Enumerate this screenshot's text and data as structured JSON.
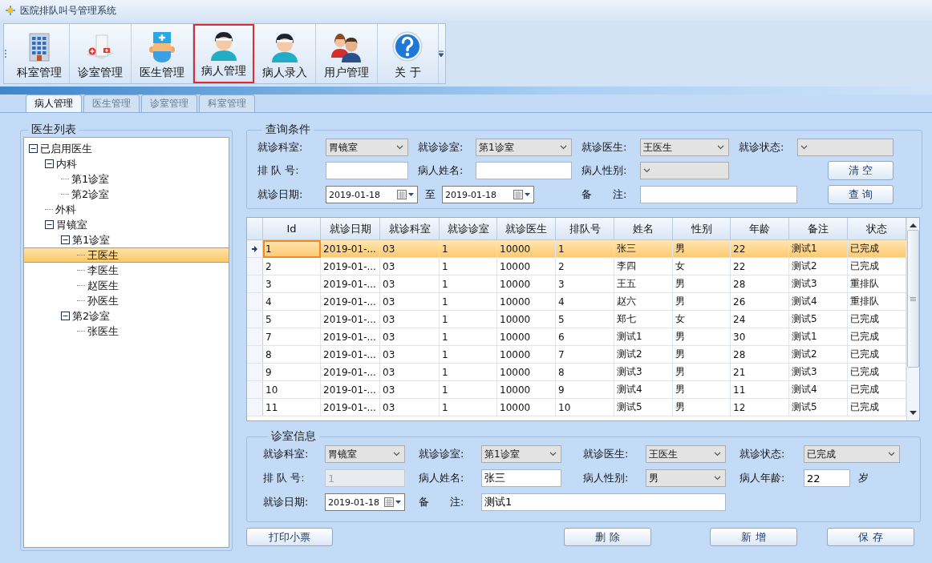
{
  "window": {
    "title": "医院排队叫号管理系统"
  },
  "toolbar": [
    {
      "kind": "building",
      "label": "科室管理",
      "selected": false
    },
    {
      "kind": "clinic",
      "label": "诊室管理",
      "selected": false
    },
    {
      "kind": "doctor",
      "label": "医生管理",
      "selected": false
    },
    {
      "kind": "patient",
      "label": "病人管理",
      "selected": true
    },
    {
      "kind": "patient",
      "label": "病人录入",
      "selected": false
    },
    {
      "kind": "users",
      "label": "用户管理",
      "selected": false
    },
    {
      "kind": "help",
      "label": "关 于",
      "selected": false
    }
  ],
  "tabs": [
    {
      "label": "病人管理",
      "selected": true
    },
    {
      "label": "医生管理",
      "selected": false
    },
    {
      "label": "诊室管理",
      "selected": false
    },
    {
      "label": "科室管理",
      "selected": false
    }
  ],
  "doctor_tree": {
    "title": "医生列表",
    "nodes": [
      {
        "label": "已启用医生",
        "expanded": true,
        "selected": false,
        "children": [
          {
            "label": "内科",
            "expanded": true,
            "selected": false,
            "children": [
              {
                "label": "第1诊室",
                "selected": false
              },
              {
                "label": "第2诊室",
                "selected": false
              }
            ]
          },
          {
            "label": "外科",
            "selected": false
          },
          {
            "label": "胃镜室",
            "expanded": true,
            "selected": false,
            "children": [
              {
                "label": "第1诊室",
                "expanded": true,
                "selected": false,
                "children": [
                  {
                    "label": "王医生",
                    "selected": true
                  },
                  {
                    "label": "李医生",
                    "selected": false
                  },
                  {
                    "label": "赵医生",
                    "selected": false
                  },
                  {
                    "label": "孙医生",
                    "selected": false
                  }
                ]
              },
              {
                "label": "第2诊室",
                "expanded": true,
                "selected": false,
                "children": [
                  {
                    "label": "张医生",
                    "selected": false
                  }
                ]
              }
            ]
          }
        ]
      }
    ]
  },
  "query": {
    "title": "查询条件",
    "rows": [
      [
        {
          "kind": "combo",
          "label": "就诊科室:",
          "value": "胃镜室"
        },
        {
          "kind": "combo",
          "label": "就诊诊室:",
          "value": "第1诊室"
        },
        {
          "kind": "combo",
          "label": "就诊医生:",
          "value": "王医生"
        },
        {
          "kind": "combo",
          "label": "就诊状态:"
        }
      ],
      [
        {
          "kind": "text",
          "label": "排 队 号:"
        },
        {
          "kind": "text",
          "label": "病人姓名:"
        },
        {
          "kind": "combo",
          "label": "病人性别:"
        },
        {
          "kind": "button",
          "label": "清 空"
        }
      ],
      [
        {
          "kind": "date",
          "label": "就诊日期:",
          "value": "2019-01-18"
        },
        {
          "kind": "date_to",
          "label": "至",
          "value": "2019-01-18"
        },
        {
          "kind": "note",
          "label": "备　　注:"
        },
        {
          "kind": "button",
          "label": "查 询"
        }
      ]
    ]
  },
  "table": {
    "columns": [
      "Id",
      "就诊日期",
      "就诊科室",
      "就诊诊室",
      "就诊医生",
      "排队号",
      "姓名",
      "性别",
      "年龄",
      "备注",
      "状态"
    ],
    "rows": [
      {
        "selected": true,
        "cells": [
          "1",
          "2019-01-...",
          "03",
          "1",
          "10000",
          "1",
          "张三",
          "男",
          "22",
          "测试1",
          "已完成"
        ]
      },
      {
        "selected": false,
        "cells": [
          "2",
          "2019-01-...",
          "03",
          "1",
          "10000",
          "2",
          "李四",
          "女",
          "22",
          "测试2",
          "已完成"
        ]
      },
      {
        "selected": false,
        "cells": [
          "3",
          "2019-01-...",
          "03",
          "1",
          "10000",
          "3",
          "王五",
          "男",
          "28",
          "测试3",
          "重排队"
        ]
      },
      {
        "selected": false,
        "cells": [
          "4",
          "2019-01-...",
          "03",
          "1",
          "10000",
          "4",
          "赵六",
          "男",
          "26",
          "测试4",
          "重排队"
        ]
      },
      {
        "selected": false,
        "cells": [
          "5",
          "2019-01-...",
          "03",
          "1",
          "10000",
          "5",
          "郑七",
          "女",
          "24",
          "测试5",
          "已完成"
        ]
      },
      {
        "selected": false,
        "cells": [
          "7",
          "2019-01-...",
          "03",
          "1",
          "10000",
          "6",
          "测试1",
          "男",
          "30",
          "测试1",
          "已完成"
        ]
      },
      {
        "selected": false,
        "cells": [
          "8",
          "2019-01-...",
          "03",
          "1",
          "10000",
          "7",
          "测试2",
          "男",
          "28",
          "测试2",
          "已完成"
        ]
      },
      {
        "selected": false,
        "cells": [
          "9",
          "2019-01-...",
          "03",
          "1",
          "10000",
          "8",
          "测试3",
          "男",
          "21",
          "测试3",
          "已完成"
        ]
      },
      {
        "selected": false,
        "cells": [
          "10",
          "2019-01-...",
          "03",
          "1",
          "10000",
          "9",
          "测试4",
          "男",
          "11",
          "测试4",
          "已完成"
        ]
      },
      {
        "selected": false,
        "cells": [
          "11",
          "2019-01-...",
          "03",
          "1",
          "10000",
          "10",
          "测试5",
          "男",
          "12",
          "测试5",
          "已完成"
        ]
      }
    ]
  },
  "info": {
    "title": "诊室信息",
    "rows": [
      [
        {
          "kind": "combo",
          "label": "就诊科室:",
          "value": "胃镜室"
        },
        {
          "kind": "combo",
          "label": "就诊诊室:",
          "value": "第1诊室"
        },
        {
          "kind": "combo",
          "label": "就诊医生:",
          "value": "王医生"
        },
        {
          "kind": "combo",
          "label": "就诊状态:",
          "value": "已完成"
        }
      ],
      [
        {
          "kind": "text",
          "label": "排 队 号:",
          "value": "1",
          "disabled": true
        },
        {
          "kind": "text",
          "label": "病人姓名:",
          "value": "张三",
          "disabled": false
        },
        {
          "kind": "combo",
          "label": "病人性别:",
          "value": "男"
        },
        {
          "kind": "text",
          "label": "病人年龄:",
          "value": "22",
          "unit": "岁",
          "disabled": false
        }
      ],
      [
        {
          "kind": "date",
          "label": "就诊日期:",
          "value": "2019-01-18"
        },
        {
          "kind": "note",
          "label": "备　　注:",
          "value": "测试1"
        }
      ]
    ]
  },
  "buttons": [
    "打印小票",
    "删 除",
    "新 增",
    "保 存"
  ]
}
